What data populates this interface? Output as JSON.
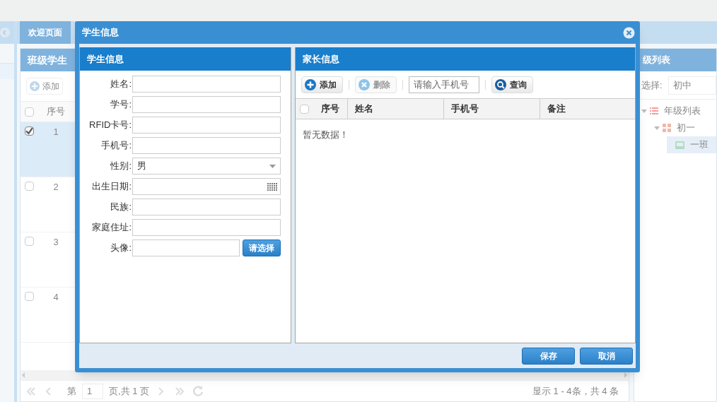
{
  "tabs": [
    {
      "label": "欢迎页面",
      "selected": true
    }
  ],
  "class_panel": {
    "title": "班级学生",
    "toolbar": [
      {
        "label": "添加"
      }
    ],
    "columns": [
      "序号"
    ],
    "all_checked": false,
    "rows": [
      {
        "index": "1",
        "checked": true,
        "selected": true
      },
      {
        "index": "2",
        "checked": false,
        "selected": false
      },
      {
        "index": "3",
        "checked": false,
        "selected": false
      },
      {
        "index": "4",
        "checked": false,
        "selected": false
      }
    ],
    "pager": {
      "page_prefix": "第",
      "page": "1",
      "page_suffix": "页,共 1 页",
      "summary": "显示 1 - 4条，共 4 条"
    }
  },
  "grade_panel": {
    "title": "级列表",
    "filter_label": "选择:",
    "filter_value": "初中",
    "tree": [
      {
        "label": "年级列表",
        "kind": "list",
        "expanded": true,
        "selected": false,
        "children": [
          {
            "label": "初一",
            "kind": "grade",
            "expanded": true,
            "selected": false,
            "children": [
              {
                "label": "一班",
                "kind": "class",
                "selected": true
              }
            ]
          }
        ]
      }
    ]
  },
  "dialog": {
    "title": "学生信息",
    "student_panel": {
      "title": "学生信息",
      "fields": [
        {
          "label": "姓名:",
          "kind": "text"
        },
        {
          "label": "学号:",
          "kind": "text"
        },
        {
          "label": "RFID卡号:",
          "kind": "text"
        },
        {
          "label": "手机号:",
          "kind": "text"
        },
        {
          "label": "性别:",
          "kind": "select",
          "value": "男"
        },
        {
          "label": "出生日期:",
          "kind": "date"
        },
        {
          "label": "民族:",
          "kind": "text"
        },
        {
          "label": "家庭住址:",
          "kind": "text"
        },
        {
          "label": "头像:",
          "kind": "file",
          "button": "请选择"
        }
      ]
    },
    "parent_panel": {
      "title": "家长信息",
      "toolbar": [
        {
          "kind": "add",
          "label": "添加",
          "disabled": false
        },
        {
          "kind": "delete",
          "label": "删除",
          "disabled": true
        },
        {
          "kind": "search",
          "placeholder": "请输入手机号"
        },
        {
          "kind": "query",
          "label": "查询",
          "disabled": false
        }
      ],
      "columns": [
        "序号",
        "姓名",
        "手机号",
        "备注"
      ],
      "all_checked": false,
      "empty_text": "暂无数据！"
    },
    "buttons": [
      "保存",
      "取消"
    ]
  }
}
